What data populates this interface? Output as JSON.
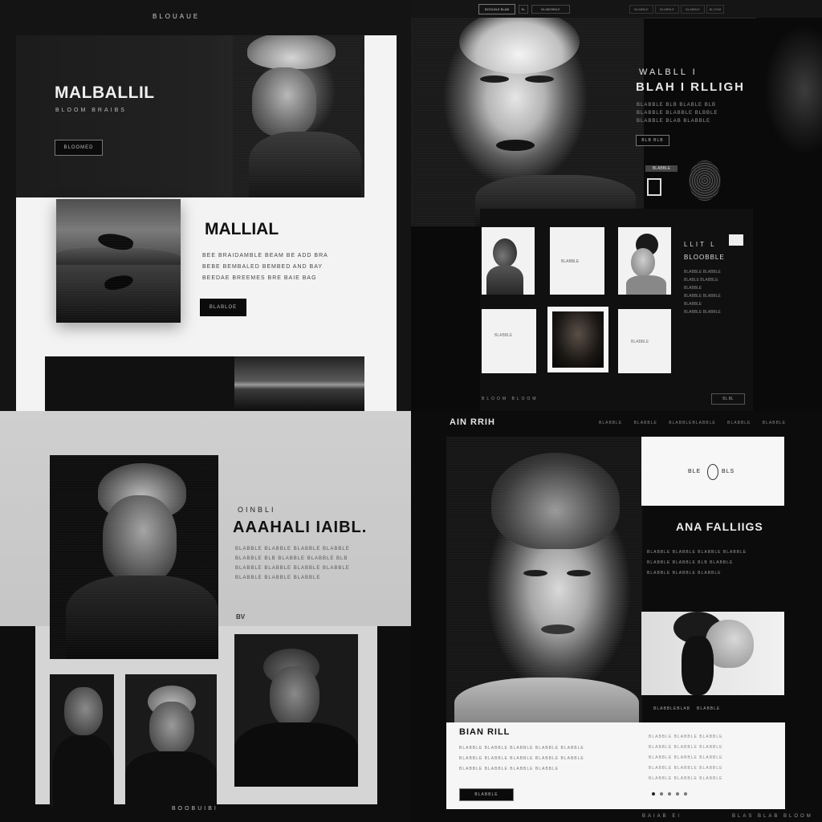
{
  "q1": {
    "top_nav": "BLOUAUE",
    "hero_title": "MALBALLIL",
    "hero_subtitle": "BLOOM BRAIBS",
    "hero_button": "BLOOMED",
    "section_title": "MALLIAL",
    "body_lines": [
      "BEE BRAIDAMBLE BEAM BE ADD BRA",
      "BEBE BEMBALED BEMBED AND BAY",
      "BEEDAE BREEMES BRE BAIE BAG"
    ],
    "section_button": "BLABLOE"
  },
  "q2": {
    "nav_items": [
      "BOOLBLE BLAB",
      "BL",
      "BLABOBBLE",
      "BLABBLE",
      "BLABBLE",
      "BLABBLE",
      "BLOOM"
    ],
    "title_small": "WALBLL I",
    "title_large": "BLAH I RLLIGH",
    "body_lines": [
      "BLABBLE BLB BLABLE BLB",
      "BLABBLE BLABBLE BLBBLE",
      "BLABBLE BLAB BLABBLE"
    ],
    "button": "BLB BLB",
    "badge_text": "BLABBLE",
    "side_heading": "LLIT L",
    "side_heading_sub": "BLOOBBLE",
    "side_lines": [
      "BLABBLE BLABBLE",
      "BLABLE BLABBLE",
      "BLABBLE",
      "BLABBLE BLABBLE",
      "BLABBLE",
      "BLABBLE BLABBLE"
    ],
    "card_labels": [
      "BLABBLE",
      "BLABBLE",
      "BLABBLE",
      "BLABBLE"
    ],
    "footer_left": "BLOOM BLOOM",
    "footer_right": "BL BL"
  },
  "q3": {
    "subtitle": "OINBLI",
    "title": "AAAHALI IAIBL.",
    "body_lines": [
      "BLABBLE BLABBLE BLABBLE BLABBLE",
      "BLABBLE BLB BLABBLE BLABBLE BLB",
      "BLABBLE BLABBLE BLABBLE BLABBLE",
      "BLABBLE BLABBLE BLABBLE"
    ],
    "small_mark": "BV",
    "footer_text": "BOOBUIBI"
  },
  "q4": {
    "brand": "AIN RRIH",
    "nav_items": [
      "BLABBLE",
      "BLABBLE",
      "BLABBLEBLABBLE",
      "BLABBLE",
      "BLABBLE"
    ],
    "card_text_left": "BLE",
    "card_text_right": "BLS",
    "title": "ANA FALLIIGS",
    "body_lines": [
      "BLABBLE BLABBLE BLABBLE BLABBLE",
      "BLABBLE BLABBLE BLB BLABBLE",
      "BLABBLE BLABBLE BLABBLE"
    ],
    "caption_left": "BLABBLEBLAB",
    "caption_right": "BLABBLE",
    "bottom_title": "BIAN RILL",
    "bottom_lines": [
      "BLABBLE BLABBLE BLABBLE BLABBLE BLABBLE",
      "BLABBLE BLABBLE BLABBLE BLABBLE BLABBLE",
      "BLABBLE BLABBLE BLABBLE BLABBLE"
    ],
    "bottom_button": "BLABBLE",
    "bottom_right_lines": [
      "BLABBLE BLABBLE BLABBLE",
      "BLABBLE BLABBLE BLABBLE",
      "BLABBLE BLABBLE BLABBLE",
      "BLABBLE BLABBLE BLABBLE",
      "BLABBLE BLABBLE BLABBLE"
    ],
    "footer_left": "BAIAB EI",
    "footer_right": "BLAS BLAB BLOOM"
  }
}
